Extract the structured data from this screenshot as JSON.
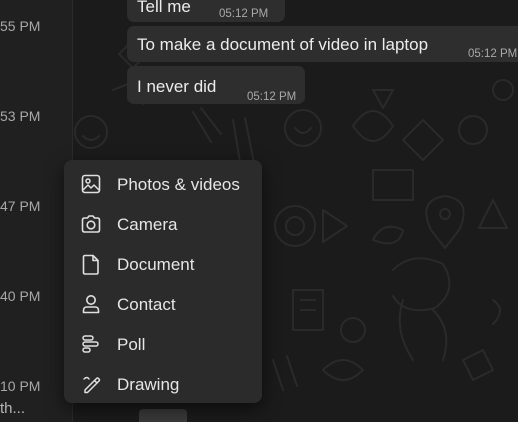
{
  "chat_list": {
    "times": [
      "55 PM",
      "53 PM",
      "47 PM",
      "40 PM",
      "10 PM"
    ],
    "preview": "th..."
  },
  "messages": [
    {
      "text": "Tell me",
      "time": "05:12 PM"
    },
    {
      "text": "To make a document of video in laptop",
      "time": "05:12 PM"
    },
    {
      "text": "I never did",
      "time": "05:12 PM"
    }
  ],
  "attach_menu": {
    "items": [
      {
        "label": "Photos & videos",
        "icon": "photos-videos-icon"
      },
      {
        "label": "Camera",
        "icon": "camera-icon"
      },
      {
        "label": "Document",
        "icon": "document-icon"
      },
      {
        "label": "Contact",
        "icon": "contact-icon"
      },
      {
        "label": "Poll",
        "icon": "poll-icon"
      },
      {
        "label": "Drawing",
        "icon": "drawing-icon"
      }
    ]
  },
  "colors": {
    "background": "#1b1b1b",
    "bubble": "#2e2e2e",
    "menu": "#2b2b2b",
    "text": "#e6e6e6",
    "muted": "#a9a9a9"
  }
}
